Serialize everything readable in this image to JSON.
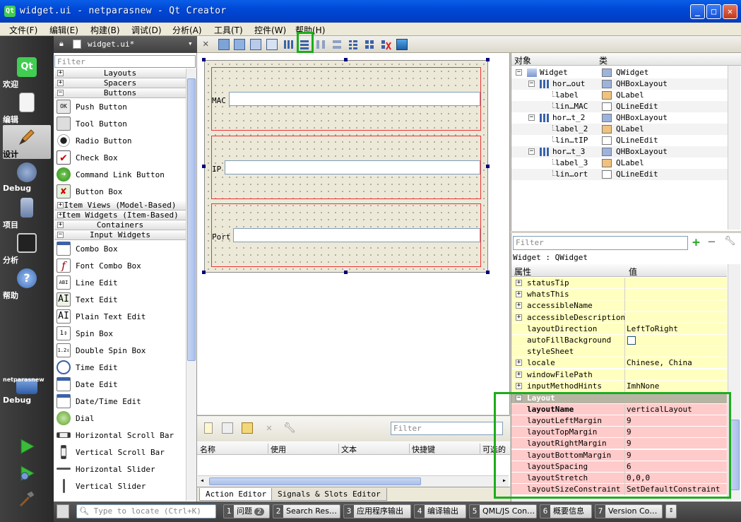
{
  "window": {
    "title": "widget.ui - netparasnew - Qt Creator",
    "app_icon": "Qt"
  },
  "menubar": {
    "items": [
      "文件(F)",
      "编辑(E)",
      "构建(B)",
      "调试(D)",
      "分析(A)",
      "工具(T)",
      "控件(W)",
      "帮助(H)"
    ]
  },
  "modes": [
    {
      "label": "欢迎",
      "icon": "qt-logo-icon"
    },
    {
      "label": "编辑",
      "icon": "document-icon"
    },
    {
      "label": "设计",
      "icon": "pencil-icon",
      "active": true
    },
    {
      "label": "Debug",
      "icon": "debug-icon"
    },
    {
      "label": "项目",
      "icon": "project-icon"
    },
    {
      "label": "分析",
      "icon": "analyze-icon"
    },
    {
      "label": "帮助",
      "icon": "help-icon"
    }
  ],
  "kit": {
    "project": "netparasnew",
    "label": "Debug"
  },
  "editor": {
    "file_name": "widget.ui*"
  },
  "widget_box": {
    "filter_placeholder": "Filter",
    "categories": {
      "layouts": "Layouts",
      "spacers": "Spacers",
      "buttons": "Buttons",
      "item_views": "Item Views (Model-Based)",
      "item_widgets": "Item Widgets (Item-Based)",
      "containers": "Containers",
      "input_widgets": "Input Widgets"
    },
    "button_items": [
      "Push Button",
      "Tool Button",
      "Radio Button",
      "Check Box",
      "Command Link Button",
      "Button Box"
    ],
    "input_items": [
      "Combo Box",
      "Font Combo Box",
      "Line Edit",
      "Text Edit",
      "Plain Text Edit",
      "Spin Box",
      "Double Spin Box",
      "Time Edit",
      "Date Edit",
      "Date/Time Edit",
      "Dial",
      "Horizontal Scroll Bar",
      "Vertical Scroll Bar",
      "Horizontal Slider",
      "Vertical Slider"
    ]
  },
  "form": {
    "labels": [
      "MAC",
      "IP",
      "Port"
    ]
  },
  "action_editor": {
    "filter_placeholder": "Filter",
    "columns": [
      "名称",
      "使用",
      "文本",
      "快捷键",
      "可选的"
    ],
    "tabs": [
      "Action Editor",
      "Signals & Slots Editor"
    ]
  },
  "object_inspector": {
    "headers": {
      "object": "对象",
      "class": "类"
    },
    "rows": [
      {
        "name": "Widget",
        "cls": "QWidget"
      },
      {
        "name": "hor…out",
        "cls": "QHBoxLayout"
      },
      {
        "name": "label",
        "cls": "QLabel"
      },
      {
        "name": "lin…MAC",
        "cls": "QLineEdit"
      },
      {
        "name": "hor…t_2",
        "cls": "QHBoxLayout"
      },
      {
        "name": "label_2",
        "cls": "QLabel"
      },
      {
        "name": "lin…tIP",
        "cls": "QLineEdit"
      },
      {
        "name": "hor…t_3",
        "cls": "QHBoxLayout"
      },
      {
        "name": "label_3",
        "cls": "QLabel"
      },
      {
        "name": "lin…ort",
        "cls": "QLineEdit"
      }
    ]
  },
  "property_editor": {
    "filter_placeholder": "Filter",
    "context": "Widget : QWidget",
    "headers": {
      "property": "属性",
      "value": "值"
    },
    "rows": [
      {
        "k": "statusTip",
        "v": "",
        "exp": true
      },
      {
        "k": "whatsThis",
        "v": "",
        "exp": true
      },
      {
        "k": "accessibleName",
        "v": "",
        "exp": true
      },
      {
        "k": "accessibleDescription",
        "v": "",
        "exp": true
      },
      {
        "k": "layoutDirection",
        "v": "LeftToRight",
        "exp": false
      },
      {
        "k": "autoFillBackground",
        "v": "",
        "exp": false
      },
      {
        "k": "styleSheet",
        "v": "",
        "exp": false
      },
      {
        "k": "locale",
        "v": "Chinese, China",
        "exp": true
      },
      {
        "k": "windowFilePath",
        "v": "",
        "exp": true
      },
      {
        "k": "inputMethodHints",
        "v": "ImhNone",
        "exp": true
      }
    ],
    "layout_group": "Layout",
    "layout_rows": [
      {
        "k": "layoutName",
        "v": "verticalLayout"
      },
      {
        "k": "layoutLeftMargin",
        "v": "9"
      },
      {
        "k": "layoutTopMargin",
        "v": "9"
      },
      {
        "k": "layoutRightMargin",
        "v": "9"
      },
      {
        "k": "layoutBottomMargin",
        "v": "9"
      },
      {
        "k": "layoutSpacing",
        "v": "6"
      },
      {
        "k": "layoutStretch",
        "v": "0,0,0"
      },
      {
        "k": "layoutSizeConstraint",
        "v": "SetDefaultConstraint"
      }
    ]
  },
  "statusbar": {
    "locator_placeholder": "Type to locate (Ctrl+K)",
    "panes": [
      {
        "num": "1",
        "label": "问题",
        "badge": "2"
      },
      {
        "num": "2",
        "label": "Search Res…"
      },
      {
        "num": "3",
        "label": "应用程序输出"
      },
      {
        "num": "4",
        "label": "编译输出"
      },
      {
        "num": "5",
        "label": "QML/JS Con…"
      },
      {
        "num": "6",
        "label": "概要信息"
      },
      {
        "num": "7",
        "label": "Version Co…"
      }
    ]
  },
  "colors": {
    "highlight": "#1cad1c",
    "layout_border": "#e33333",
    "changed_property": "#ffcaca",
    "property_row": "#ffffc0"
  }
}
